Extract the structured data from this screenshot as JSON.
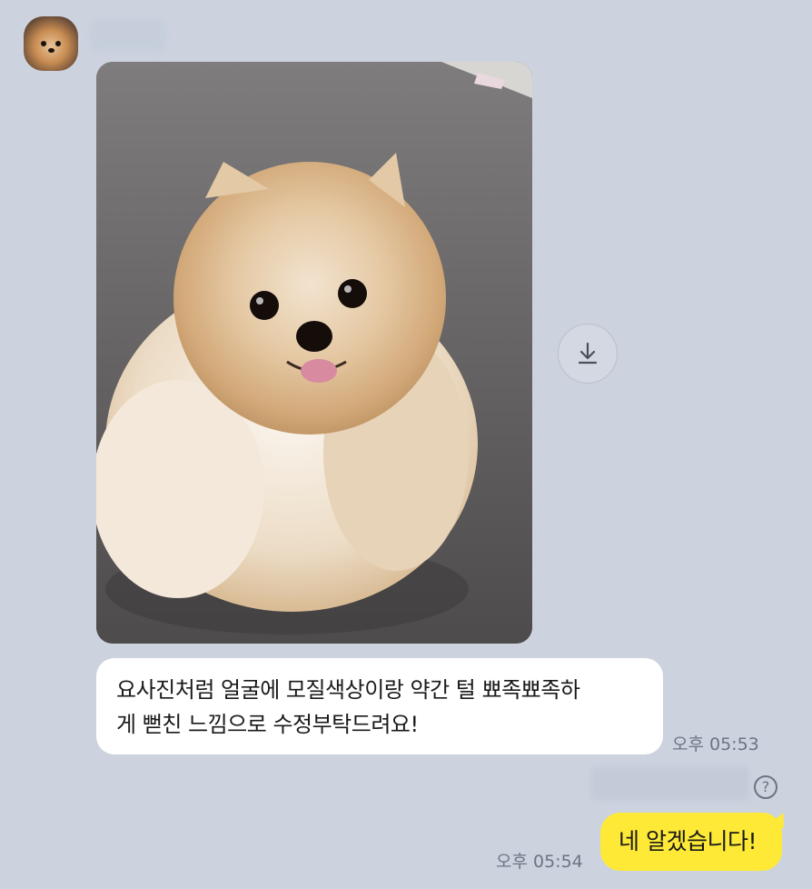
{
  "chat": {
    "sender": {
      "name_hidden": "",
      "avatar_icon": "pomeranian-avatar"
    },
    "incoming": {
      "image_alt": "pomeranian-photo",
      "download_icon": "download-icon",
      "text_line1": "요사진처럼 얼굴에 모질색상이랑 약간 털 뾰족뾰족하",
      "text_line2": "게 뻗친 느낌으로 수정부탁드려요!",
      "time": "오후 05:53"
    },
    "outgoing": {
      "status_hidden": "",
      "help_icon_label": "?",
      "text": "네 알겠습니다!",
      "time": "오후 05:54"
    }
  },
  "colors": {
    "background": "#ccd3df",
    "incoming_bubble": "#ffffff",
    "outgoing_bubble": "#fde936",
    "timestamp": "#6c7484"
  }
}
